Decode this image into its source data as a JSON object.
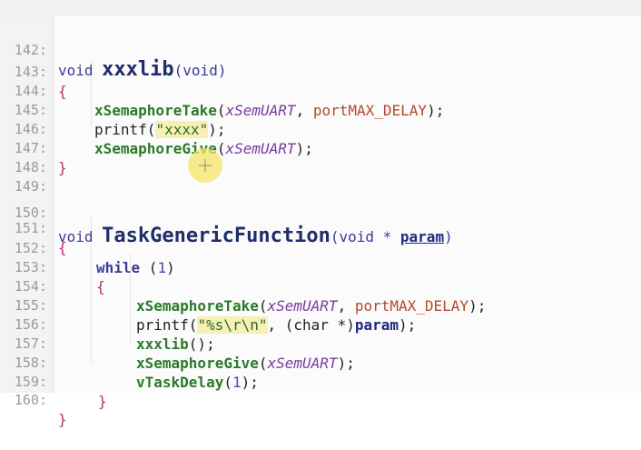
{
  "lines": [
    {
      "n": "142:"
    },
    {
      "n": "143:"
    },
    {
      "n": "144:"
    },
    {
      "n": "145:"
    },
    {
      "n": "146:"
    },
    {
      "n": "147:"
    },
    {
      "n": "148:"
    },
    {
      "n": "149:"
    },
    {
      "n": "150:"
    },
    {
      "n": "151:"
    },
    {
      "n": "152:"
    },
    {
      "n": "153:"
    },
    {
      "n": "154:"
    },
    {
      "n": "155:"
    },
    {
      "n": "156:"
    },
    {
      "n": "157:"
    },
    {
      "n": "158:"
    },
    {
      "n": "159:"
    },
    {
      "n": "160:"
    }
  ],
  "tokens": {
    "void": "void",
    "xxxlib": "xxxlib",
    "void_param": "(void)",
    "open_brace": "{",
    "close_brace": "}",
    "sem_take": "xSemaphoreTake",
    "sem_give": "xSemaphoreGive",
    "sem_uart": "xSemUART",
    "port_max": "portMAX_DELAY",
    "printf": "printf",
    "str_xxxx": "\"xxxx\"",
    "task_fn": "TaskGenericFunction",
    "task_param_open": "(void * ",
    "param": "param",
    "while": "while",
    "one": "1",
    "fmt_str": "\"%s\\r\\n\"",
    "char_cast": "(char *)",
    "xxxlib_call": "xxxlib",
    "vtask": "vTaskDelay"
  }
}
